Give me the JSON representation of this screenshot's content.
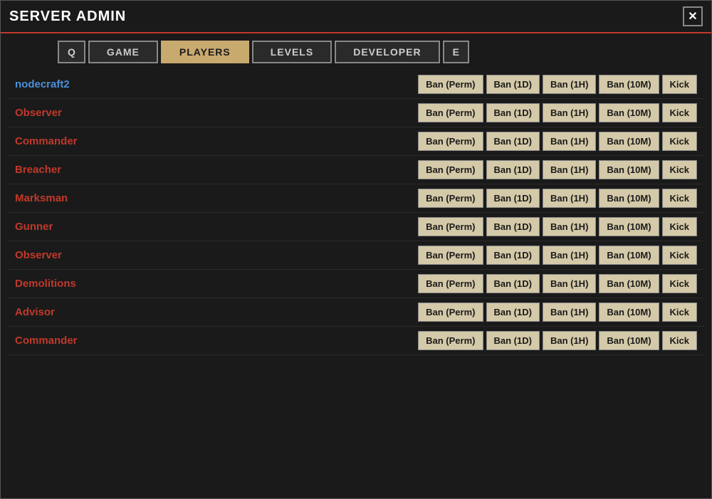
{
  "window": {
    "title": "SERVER ADMIN",
    "close_label": "✕"
  },
  "tabs": {
    "q_label": "Q",
    "game_label": "GAME",
    "players_label": "PLAYERS",
    "levels_label": "LEVELS",
    "developer_label": "DEVELOPER",
    "e_label": "E"
  },
  "players": [
    {
      "name": "nodecraft2",
      "color": "blue"
    },
    {
      "name": "Observer",
      "color": "red"
    },
    {
      "name": "Commander",
      "color": "red"
    },
    {
      "name": "Breacher",
      "color": "red"
    },
    {
      "name": "Marksman",
      "color": "red"
    },
    {
      "name": "Gunner",
      "color": "red"
    },
    {
      "name": "Observer",
      "color": "red"
    },
    {
      "name": "Demolitions",
      "color": "red"
    },
    {
      "name": "Advisor",
      "color": "red"
    },
    {
      "name": "Commander",
      "color": "red"
    }
  ],
  "action_buttons": {
    "ban_perm": "Ban (Perm)",
    "ban_1d": "Ban (1D)",
    "ban_1h": "Ban (1H)",
    "ban_10m": "Ban (10M)",
    "kick": "Kick"
  }
}
